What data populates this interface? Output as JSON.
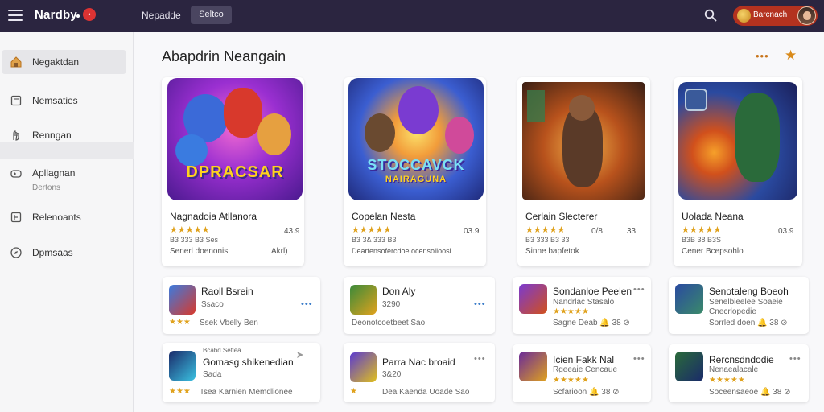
{
  "header": {
    "brand": "Nardby",
    "badge": "•",
    "nav": [
      "Nepadde",
      "Seltco"
    ],
    "user_name": "Barcnach"
  },
  "sidebar": {
    "items": [
      {
        "label": "Negaktdan",
        "icon": "home-icon"
      },
      {
        "label": "Nemsaties",
        "icon": "document-icon"
      },
      {
        "label": "Renngan",
        "icon": "hand-icon"
      },
      {
        "label": "Apllagnan",
        "sub": "Dertons",
        "icon": "gamepad-icon"
      },
      {
        "label": "Relenoants",
        "icon": "chart-icon"
      },
      {
        "label": "Dpmsaas",
        "icon": "compass-icon"
      }
    ]
  },
  "main": {
    "section_title": "Abapdrin Neangain",
    "more": "•••",
    "star": "★"
  },
  "featured": [
    {
      "art_text": "DPRACSAR",
      "title": "Nagnadoia Atllanora",
      "rating": "★★★★★",
      "score": "43.9",
      "meta": "B3 333 B3 Ses",
      "sub": "Senerl doenonis",
      "sub2": "Akrl)",
      "icon": "game-art-icon"
    },
    {
      "art_text": "STOCCAVCK",
      "art_text2": "NAIRAGUNA",
      "title": "Copelan Nesta",
      "rating": "★★★★★",
      "score": "03.9",
      "meta": "B3 3& 333 B3",
      "sub": "Dearfensofercdoe ocensoiloosi",
      "icon": "game-art-icon"
    },
    {
      "title": "Cerlain Slecterer",
      "rating": "★★★★★",
      "score": "0/8",
      "score2": "33",
      "meta": "B3 333 B3 33",
      "sub": "Sinne bapfetok",
      "icon": "game-art-icon"
    },
    {
      "title": "Uolada Neana",
      "rating": "★★★★★",
      "score": "03.9",
      "meta": "B3B 38 B3S",
      "sub": "Cener Bcepsohlo",
      "icon": "game-art-icon"
    }
  ],
  "small_cards": [
    {
      "title": "Raoll Bsrein",
      "line": "Ssaco",
      "stars": "★★★",
      "sub": "Ssek Vbelly Ben",
      "icon": "game-icon"
    },
    {
      "title": "Don Aly",
      "line": "3290",
      "sub": "Deonotcoetbeet Sao",
      "icon": "game-icon"
    },
    {
      "title": "Sondanloe Peelen",
      "line": "Nandrlac Stasalo",
      "stars": "★★★★★",
      "sub": "Sagne Deab 🔔 38 ⊘",
      "icon": "game-icon"
    },
    {
      "title": "Senotaleng Boeoh",
      "line": "Senelbieelee Soaeie",
      "line2": "Cnecrlopedie",
      "sub": "Sorrled doen 🔔 38 ⊘",
      "icon": "game-icon"
    },
    {
      "title": "Gomasg shikenedian",
      "pretitle": "Bcabd Setlea",
      "line": "Sada",
      "stars": "★★★",
      "sub": "Tsea Karnien Memdlionee",
      "icon": "game-icon"
    },
    {
      "title": "Parra Nac broaid",
      "line": "3&20",
      "stars": "★",
      "sub": "Dea Kaenda Uoade Sao",
      "icon": "game-icon"
    },
    {
      "title": "Icien Fakk Nal",
      "line": "Rgeeaie Cencaue",
      "stars": "★★★★★",
      "sub": "Scfarioon 🔔 38 ⊘",
      "icon": "game-icon"
    },
    {
      "title": "Rercnsdndodie",
      "line": "Nenaealacale",
      "stars": "★★★★★",
      "sub": "Soceensaeoe 🔔 38 ⊘",
      "icon": "game-icon"
    }
  ]
}
